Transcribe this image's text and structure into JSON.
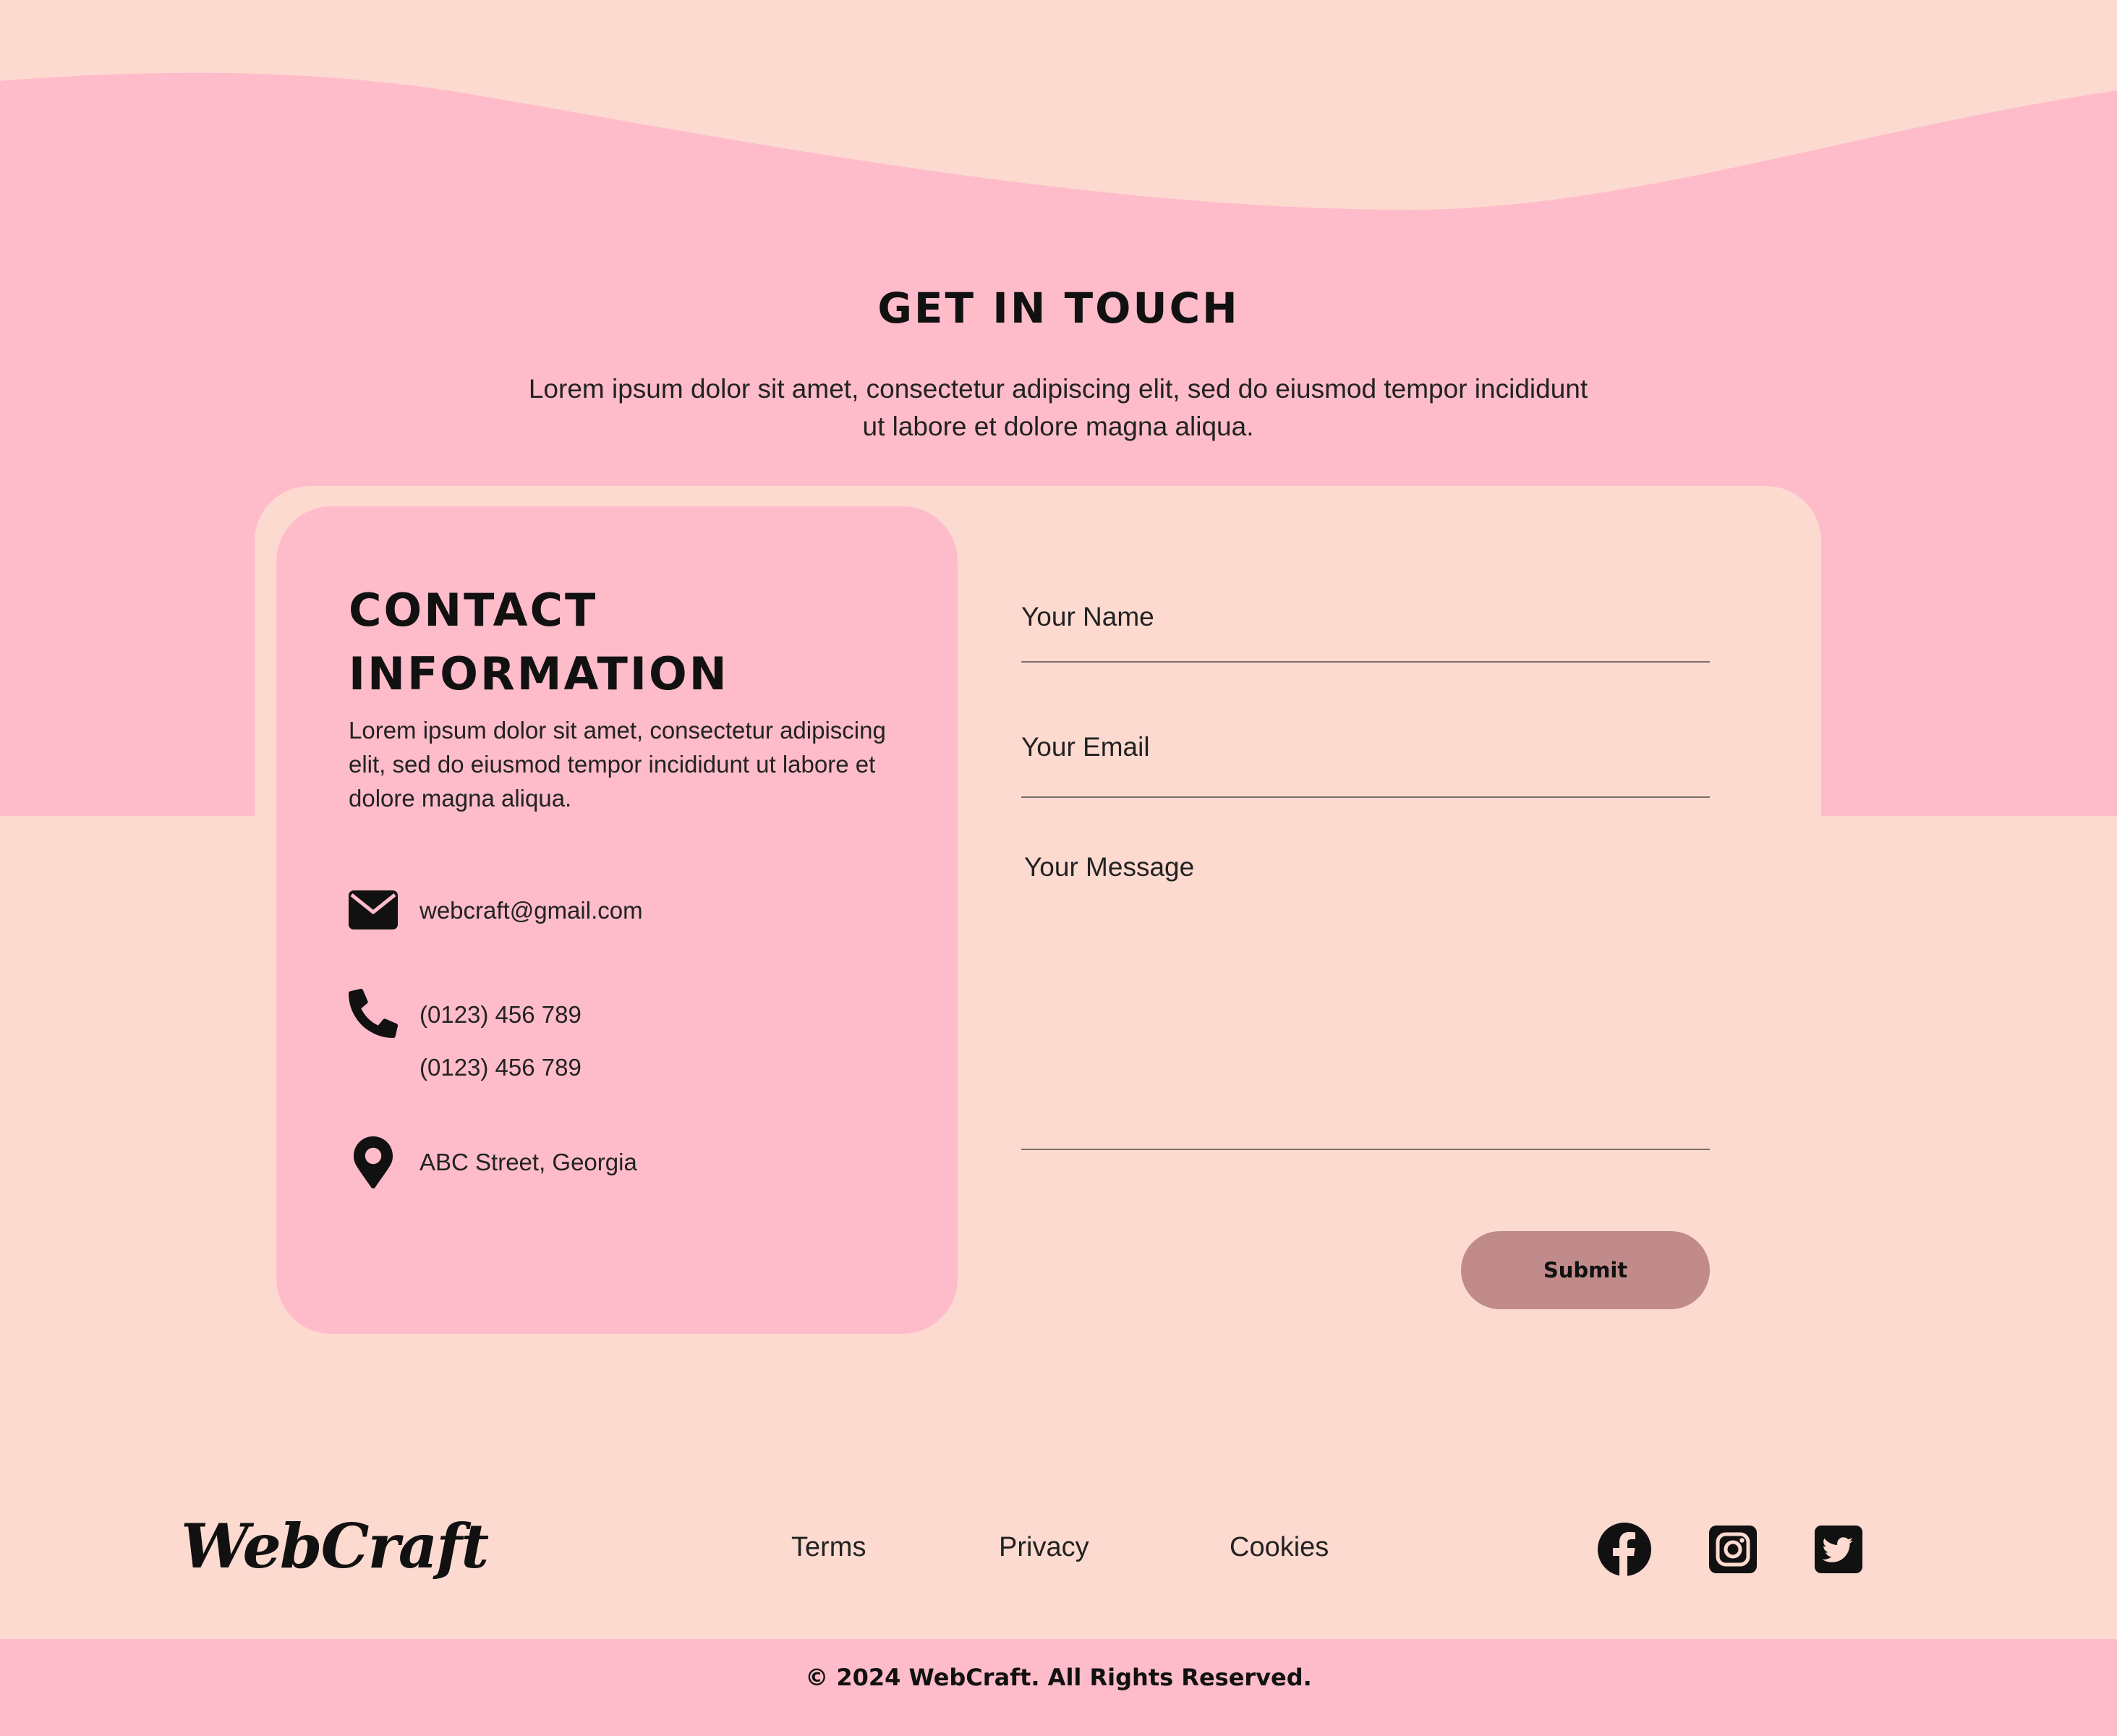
{
  "colors": {
    "background_peach": "#FDDAD0",
    "band_pink": "#FEBCCA",
    "submit_button": "#C08B8A",
    "text_dark": "#111111"
  },
  "hero": {
    "title": "GET IN TOUCH",
    "subtitle": "Lorem ipsum dolor sit amet, consectetur adipiscing elit, sed do eiusmod tempor incididunt ut labore et dolore magna aliqua."
  },
  "contact_info": {
    "title": "Contact Information",
    "description": "Lorem ipsum dolor sit amet, consectetur adipiscing elit, sed do eiusmod tempor incididunt ut labore et dolore magna aliqua.",
    "email": {
      "icon": "envelope-icon",
      "value": "webcraft@gmail.com"
    },
    "phone": {
      "icon": "phone-icon",
      "values": [
        "(0123) 456 789",
        "(0123) 456 789"
      ]
    },
    "address": {
      "icon": "map-pin-icon",
      "value": "ABC Street, Georgia"
    }
  },
  "form": {
    "name_placeholder": "Your Name",
    "email_placeholder": "Your Email",
    "message_placeholder": "Your Message",
    "submit_label": "Submit"
  },
  "footer": {
    "logo": "WebCraft",
    "links": [
      "Terms",
      "Privacy",
      "Cookies"
    ],
    "social_icons": [
      "facebook-icon",
      "instagram-icon",
      "twitter-icon"
    ],
    "copyright": "© 2024 WebCraft. All Rights Reserved."
  }
}
